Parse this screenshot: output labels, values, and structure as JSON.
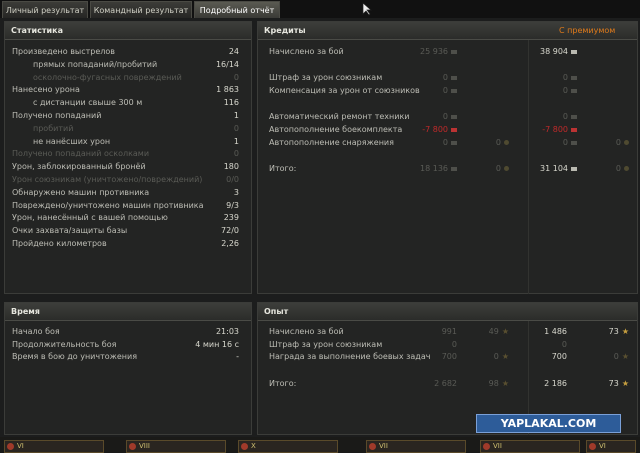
{
  "tabs": [
    {
      "label": "Личный результат",
      "active": false
    },
    {
      "label": "Командный результат",
      "active": false
    },
    {
      "label": "Подробный отчёт",
      "active": true
    }
  ],
  "stats": {
    "title": "Статистика",
    "rows": [
      {
        "label": "Произведено выстрелов",
        "value": "24",
        "indent": 0,
        "dim": false
      },
      {
        "label": "прямых попаданий/пробитий",
        "value": "16/14",
        "indent": 1,
        "dim": false
      },
      {
        "label": "осколочно-фугасных повреждений",
        "value": "0",
        "indent": 1,
        "dim": true
      },
      {
        "label": "Нанесено урона",
        "value": "1 863",
        "indent": 0,
        "dim": false
      },
      {
        "label": "с дистанции свыше 300 м",
        "value": "116",
        "indent": 1,
        "dim": false
      },
      {
        "label": "Получено попаданий",
        "value": "1",
        "indent": 0,
        "dim": false
      },
      {
        "label": "пробитий",
        "value": "0",
        "indent": 1,
        "dim": true
      },
      {
        "label": "не нанёсших урон",
        "value": "1",
        "indent": 1,
        "dim": false
      },
      {
        "label": "Получено попаданий осколками",
        "value": "0",
        "indent": 0,
        "dim": true
      },
      {
        "label": "Урон, заблокированный бронёй",
        "value": "180",
        "indent": 0,
        "dim": false
      },
      {
        "label": "Урон союзникам (уничтожено/повреждений)",
        "value": "0/0",
        "indent": 0,
        "dim": true
      },
      {
        "label": "Обнаружено машин противника",
        "value": "3",
        "indent": 0,
        "dim": false
      },
      {
        "label": "Повреждено/уничтожено машин противника",
        "value": "9/3",
        "indent": 0,
        "dim": false
      },
      {
        "label": "Урон, нанесённый с вашей помощью",
        "value": "239",
        "indent": 0,
        "dim": false
      },
      {
        "label": "Очки захвата/защиты базы",
        "value": "72/0",
        "indent": 0,
        "dim": false
      },
      {
        "label": "Пройдено километров",
        "value": "2,26",
        "indent": 0,
        "dim": false
      }
    ]
  },
  "credits": {
    "title": "Кредиты",
    "premium_label": "С премиумом",
    "rows": [
      {
        "label": "Начислено за бой",
        "base": "25 936",
        "prem": "38 904",
        "base_dim": true,
        "prem_dim": false,
        "gold": false
      },
      {
        "label": "Штраф за урон союзникам",
        "base": "0",
        "prem": "0",
        "base_dim": true,
        "prem_dim": true,
        "gold": false
      },
      {
        "label": "Компенсация за урон от союзников",
        "base": "0",
        "prem": "0",
        "base_dim": true,
        "prem_dim": true,
        "gold": false
      },
      {
        "label": "Автоматический ремонт техники",
        "base": "0",
        "prem": "0",
        "base_dim": true,
        "prem_dim": true,
        "gold": false
      },
      {
        "label": "Автопополнение боекомплекта",
        "base": "-7 800",
        "prem": "-7 800",
        "base_dim": true,
        "prem_dim": false,
        "red": true,
        "gold": false
      },
      {
        "label": "Автопополнение снаряжения",
        "base": "0",
        "prem": "0",
        "base_dim": true,
        "prem_dim": true,
        "gold": true,
        "gold_base": "0",
        "gold_prem": "0"
      }
    ],
    "total": {
      "label": "Итого:",
      "base": "18 136",
      "prem": "31 104",
      "gold_base": "0",
      "gold_prem": "0"
    }
  },
  "time": {
    "title": "Время",
    "rows": [
      {
        "label": "Начало боя",
        "value": "21:03"
      },
      {
        "label": "Продолжительность боя",
        "value": "4 мин 16 с"
      },
      {
        "label": "Время в бою до уничтожения",
        "value": "-"
      }
    ]
  },
  "experience": {
    "title": "Опыт",
    "rows": [
      {
        "label": "Начислено за бой",
        "base": "991",
        "base_free": "49",
        "prem": "1 486",
        "prem_free": "73"
      },
      {
        "label": "Штраф за урон союзникам",
        "base": "0",
        "base_free": "",
        "prem": "0",
        "prem_free": ""
      },
      {
        "label": "Награда за выполнение боевых задач",
        "base": "700",
        "base_free": "0",
        "prem": "700",
        "prem_free": "0"
      }
    ],
    "total": {
      "label": "Итого:",
      "base": "2 682",
      "base_free": "98",
      "prem": "2 186",
      "prem_free": "73"
    }
  },
  "watermark": "YAPLAKAL.COM",
  "bottom_slots": [
    "VI",
    "VIII",
    "X",
    "VII",
    "VII",
    "VI"
  ],
  "colors": {
    "accent": "#e07a1a",
    "negative": "#c02a2a",
    "text": "#bdbdb5",
    "dim": "#5a5b56"
  }
}
